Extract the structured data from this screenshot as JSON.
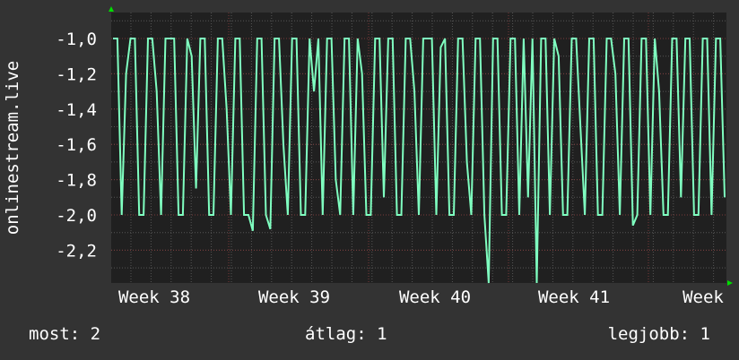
{
  "chart_data": {
    "type": "line",
    "ylabel": "onlinestream.live",
    "ylim": [
      -2.386,
      -0.853
    ],
    "yticks": [
      "-1,0",
      "-1,2",
      "-1,4",
      "-1,6",
      "-1,8",
      "-2,0",
      "-2,2"
    ],
    "ytick_values": [
      -1.0,
      -1.2,
      -1.4,
      -1.6,
      -1.8,
      -2.0,
      -2.2
    ],
    "xticks": [
      "Week 38",
      "Week 39",
      "Week 40",
      "Week 41",
      "Week"
    ],
    "grid": true,
    "line_color": "#7FFFC0",
    "values": [
      -1,
      -1,
      -2,
      -1.2,
      -1,
      -1,
      -2,
      -2,
      -1,
      -1,
      -1.3,
      -2,
      -1,
      -1,
      -1,
      -2,
      -2,
      -1,
      -1.1,
      -1.85,
      -1,
      -1,
      -2,
      -2,
      -1,
      -1,
      -1.4,
      -2,
      -1,
      -1,
      -2,
      -2,
      -2.09,
      -1,
      -1,
      -2,
      -2.08,
      -1,
      -1,
      -1.6,
      -2,
      -1,
      -1,
      -2,
      -2,
      -1,
      -1.3,
      -1,
      -2,
      -1,
      -1,
      -1.8,
      -2,
      -1,
      -1,
      -2,
      -1,
      -1.2,
      -2,
      -2,
      -1,
      -1,
      -1.9,
      -1,
      -1,
      -2,
      -2,
      -1,
      -1,
      -1.3,
      -2,
      -1,
      -1,
      -1,
      -2,
      -1.05,
      -1,
      -2,
      -2,
      -1,
      -1,
      -1.7,
      -2,
      -1,
      -1,
      -2,
      -2.4,
      -1,
      -1,
      -2,
      -2,
      -1,
      -1,
      -2,
      -1,
      -1.9,
      -1,
      -2.4,
      -1,
      -1,
      -2,
      -1,
      -1.1,
      -2,
      -2,
      -1,
      -1,
      -1.5,
      -2,
      -1,
      -1,
      -2,
      -2,
      -1,
      -1,
      -1.2,
      -2,
      -1,
      -1,
      -2.06,
      -2,
      -1,
      -1,
      -2,
      -1,
      -1.3,
      -2,
      -2,
      -1,
      -1,
      -1.9,
      -1,
      -1,
      -2,
      -2,
      -1,
      -1,
      -2,
      -1,
      -1,
      -1.9
    ]
  },
  "legend": {
    "current": "most: 2",
    "average": "átlag: 1",
    "best": "legjobb: 1"
  }
}
